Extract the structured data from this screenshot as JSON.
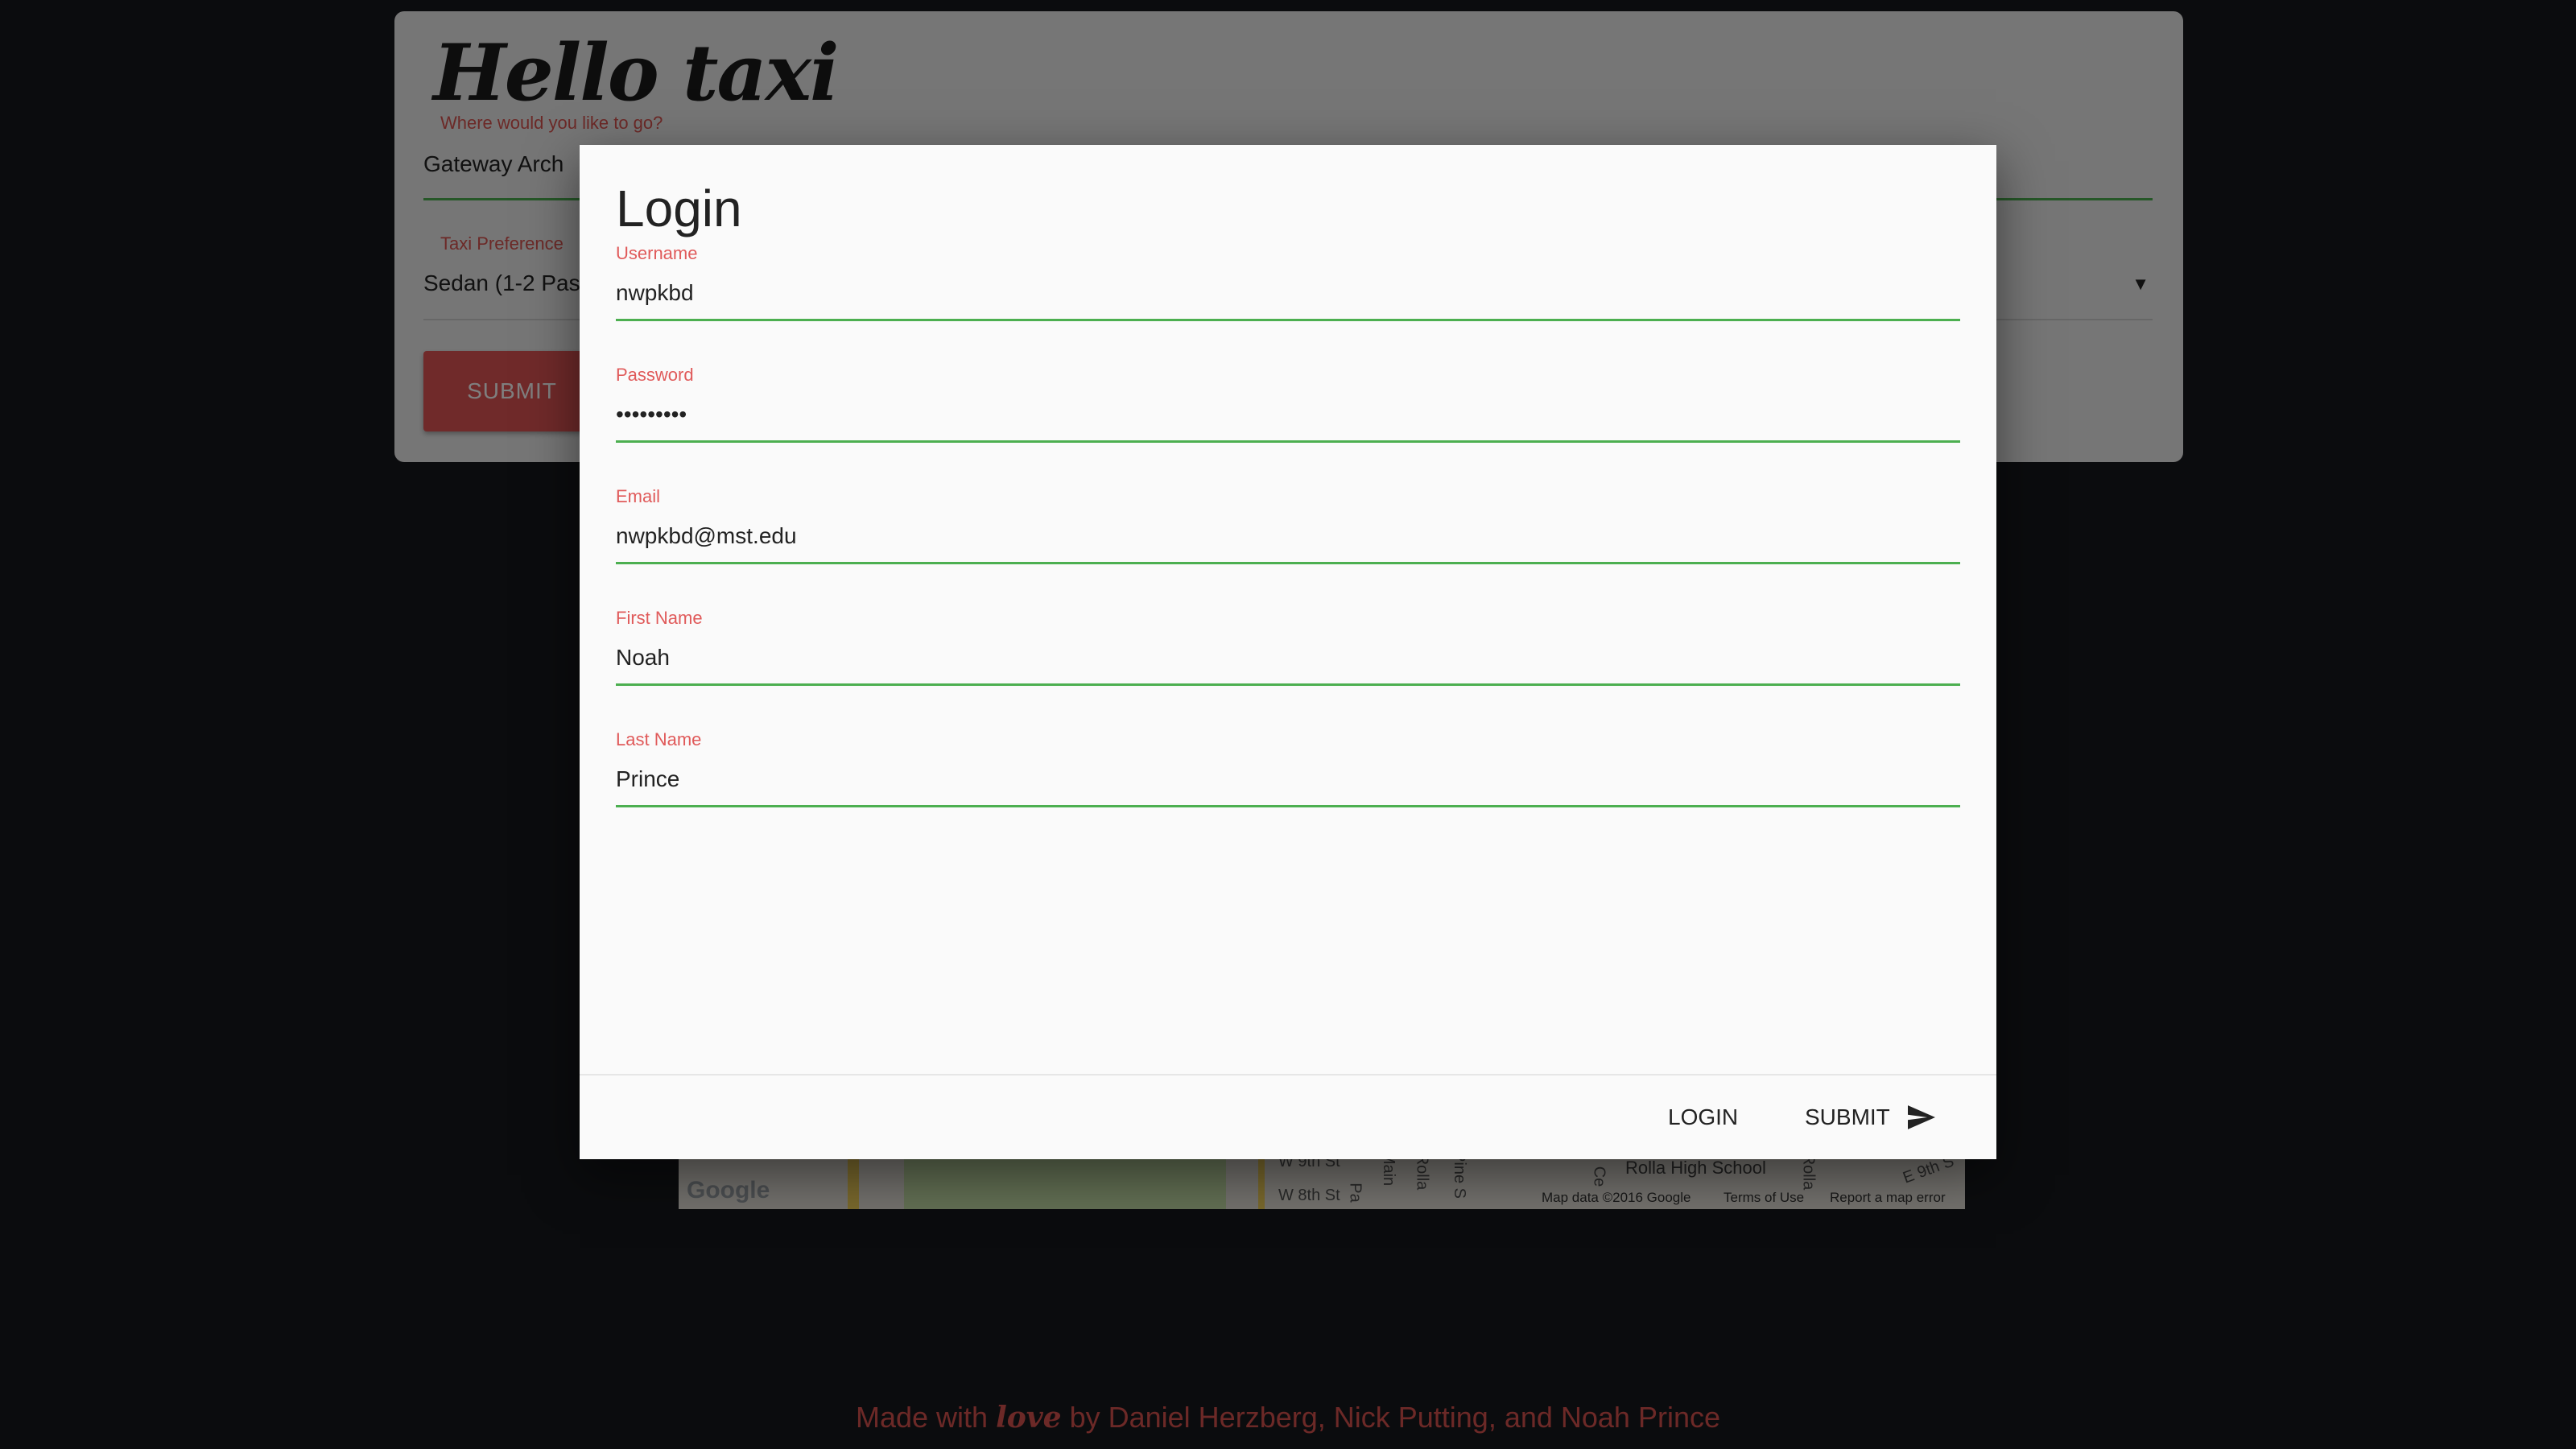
{
  "app": {
    "brand": "Hello taxi",
    "destination_label": "Where would you like to go?",
    "destination_value": "Gateway Arch",
    "taxi_pref_label": "Taxi Preference",
    "taxi_pref_value": "Sedan (1-2 Passengers)",
    "submit_label": "SUBMIT"
  },
  "map": {
    "streets": [
      "W 9th St",
      "W 8th St",
      "Main",
      "Pa",
      "Rolla",
      "Pine S",
      "Ce",
      "Rolla High School",
      "Rolla",
      "E 9th S"
    ],
    "google_logo": "Google",
    "attribution": [
      "Map data ©2016 Google",
      "Terms of Use",
      "Report a map error"
    ]
  },
  "dialog": {
    "title": "Login",
    "fields": [
      {
        "label": "Username",
        "value": "nwpkbd"
      },
      {
        "label": "Password",
        "value": "•••••••••"
      },
      {
        "label": "Email",
        "value": "nwpkbd@mst.edu"
      },
      {
        "label": "First Name",
        "value": "Noah"
      },
      {
        "label": "Last Name",
        "value": "Prince"
      }
    ],
    "login_label": "LOGIN",
    "submit_label": "SUBMIT",
    "submit_icon": "send-icon"
  },
  "footer": {
    "prefix": "Made with ",
    "love": "love",
    "suffix": " by Daniel Herzberg, Nick Putting, and Noah Prince"
  },
  "colors": {
    "accent_red": "#e05a5a",
    "accent_green": "#4caf50",
    "page_bg": "#17181c"
  }
}
